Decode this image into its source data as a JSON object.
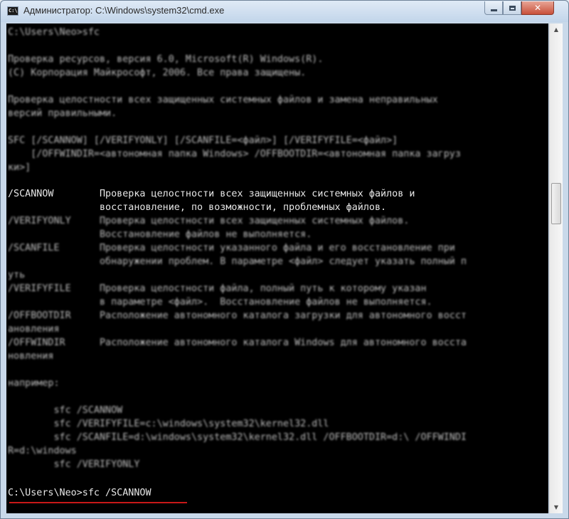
{
  "window": {
    "title": "Администратор: C:\\Windows\\system32\\cmd.exe",
    "icon_label": "C:\\"
  },
  "console": {
    "lines": [
      {
        "text": "C:\\Users\\Neo>sfc",
        "style": "blur"
      },
      {
        "text": "",
        "style": "blur"
      },
      {
        "text": "Проверка ресурсов, версия 6.0, Microsoft(R) Windows(R).",
        "style": "blur"
      },
      {
        "text": "(C) Корпорация Майкрософт, 2006. Все права защищены.",
        "style": "blur"
      },
      {
        "text": "",
        "style": "blur"
      },
      {
        "text": "Проверка целостности всех защищенных системных файлов и замена неправильных",
        "style": "blur"
      },
      {
        "text": "версий правильными.",
        "style": "blur"
      },
      {
        "text": "",
        "style": "blur"
      },
      {
        "text": "SFC [/SCANNOW] [/VERIFYONLY] [/SCANFILE=<файл>] [/VERIFYFILE=<файл>]",
        "style": "blur"
      },
      {
        "text": "    [/OFFWINDIR=<автономная папка Windows> /OFFBOOTDIR=<автономная папка загруз",
        "style": "blur"
      },
      {
        "text": "ки>]",
        "style": "blur"
      },
      {
        "text": "",
        "style": "blur"
      },
      {
        "text": "/SCANNOW        Проверка целостности всех защищенных системных файлов и",
        "style": "sharp"
      },
      {
        "text": "                восстановление, по возможности, проблемных файлов.",
        "style": "sharp"
      },
      {
        "text": "/VERIFYONLY     Проверка целостности всех защищенных системных файлов.",
        "style": "blur"
      },
      {
        "text": "                Восстановление файлов не выполняется.",
        "style": "blur"
      },
      {
        "text": "/SCANFILE       Проверка целостности указанного файла и его восстановление при",
        "style": "blur"
      },
      {
        "text": "                обнаружении проблем. В параметре <файл> следует указать полный п",
        "style": "blur"
      },
      {
        "text": "уть",
        "style": "blur"
      },
      {
        "text": "/VERIFYFILE     Проверка целостности файла, полный путь к которому указан",
        "style": "blur"
      },
      {
        "text": "                в параметре <файл>.  Восстановление файлов не выполняется.",
        "style": "blur"
      },
      {
        "text": "/OFFBOOTDIR     Расположение автономного каталога загрузки для автономного восст",
        "style": "blur"
      },
      {
        "text": "ановления",
        "style": "blur"
      },
      {
        "text": "/OFFWINDIR      Расположение автономного каталога Windows для автономного восста",
        "style": "blur"
      },
      {
        "text": "новления",
        "style": "blur"
      },
      {
        "text": "",
        "style": "blur"
      },
      {
        "text": "например:",
        "style": "blur"
      },
      {
        "text": "",
        "style": "blur"
      },
      {
        "text": "        sfc /SCANNOW",
        "style": "blur"
      },
      {
        "text": "        sfc /VERIFYFILE=c:\\windows\\system32\\kernel32.dll",
        "style": "blur"
      },
      {
        "text": "        sfc /SCANFILE=d:\\windows\\system32\\kernel32.dll /OFFBOOTDIR=d:\\ /OFFWINDI",
        "style": "blur"
      },
      {
        "text": "R=d:\\windows",
        "style": "blur"
      },
      {
        "text": "        sfc /VERIFYONLY",
        "style": "blur"
      },
      {
        "text": "",
        "style": "blur"
      },
      {
        "text": "C:\\Users\\Neo>sfc /SCANNOW",
        "style": "sharp"
      }
    ]
  }
}
